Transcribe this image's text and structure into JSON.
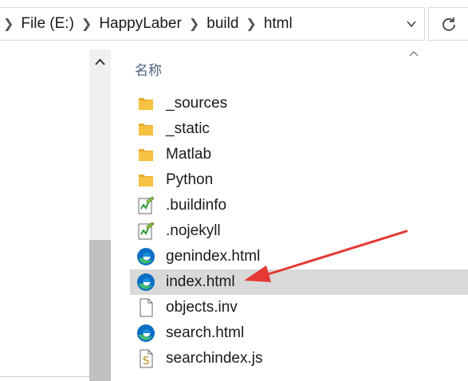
{
  "address_bar": {
    "crumbs": [
      "File (E:)",
      "HappyLaber",
      "build",
      "html"
    ]
  },
  "file_list": {
    "column_name_header": "名称",
    "items": [
      {
        "name": "_sources",
        "icon": "folder-icon"
      },
      {
        "name": "_static",
        "icon": "folder-icon"
      },
      {
        "name": "Matlab",
        "icon": "folder-icon"
      },
      {
        "name": "Python",
        "icon": "folder-icon"
      },
      {
        "name": ".buildinfo",
        "icon": "notepad-file-icon"
      },
      {
        "name": ".nojekyll",
        "icon": "notepad-file-icon"
      },
      {
        "name": "genindex.html",
        "icon": "edge-html-icon"
      },
      {
        "name": "index.html",
        "icon": "edge-html-icon",
        "selected": true
      },
      {
        "name": "objects.inv",
        "icon": "blank-file-icon"
      },
      {
        "name": "search.html",
        "icon": "edge-html-icon"
      },
      {
        "name": "searchindex.js",
        "icon": "js-script-icon"
      }
    ]
  },
  "colors": {
    "selection": "#d9d9d9",
    "folder": "#f5c242",
    "edge_blue": "#0c6fc7",
    "edge_green": "#3fbf6a",
    "arrow": "#e53935",
    "header_text": "#4c607a"
  }
}
